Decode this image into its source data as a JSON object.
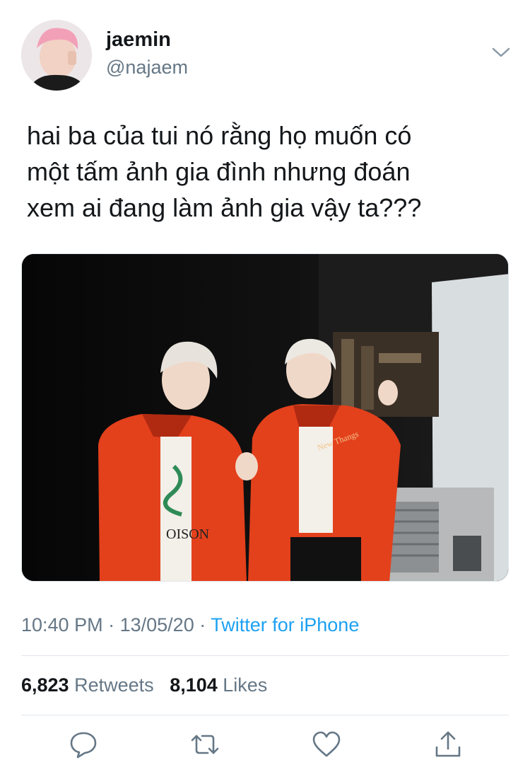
{
  "tweet": {
    "author": {
      "display_name": "jaemin",
      "handle": "@najaem"
    },
    "text_lines": [
      "hai ba của tui nó rằng họ muốn có",
      "một tấm ảnh gia đình nhưng đoán",
      "xem ai đang làm ảnh gia vậy ta???"
    ],
    "time": "10:40 PM",
    "date": "13/05/20",
    "separator": "·",
    "source": "Twitter for iPhone",
    "retweets_count": "6,823",
    "retweets_label": "Retweets",
    "likes_count": "8,104",
    "likes_label": "Likes"
  },
  "icons": {
    "more": "chevron-down-icon",
    "reply": "reply-icon",
    "retweet": "retweet-icon",
    "like": "heart-icon",
    "share": "share-icon"
  },
  "colors": {
    "accent": "#1da1f2",
    "secondary_text": "#657786",
    "primary_text": "#14171a",
    "divider": "#e1e8ed"
  }
}
